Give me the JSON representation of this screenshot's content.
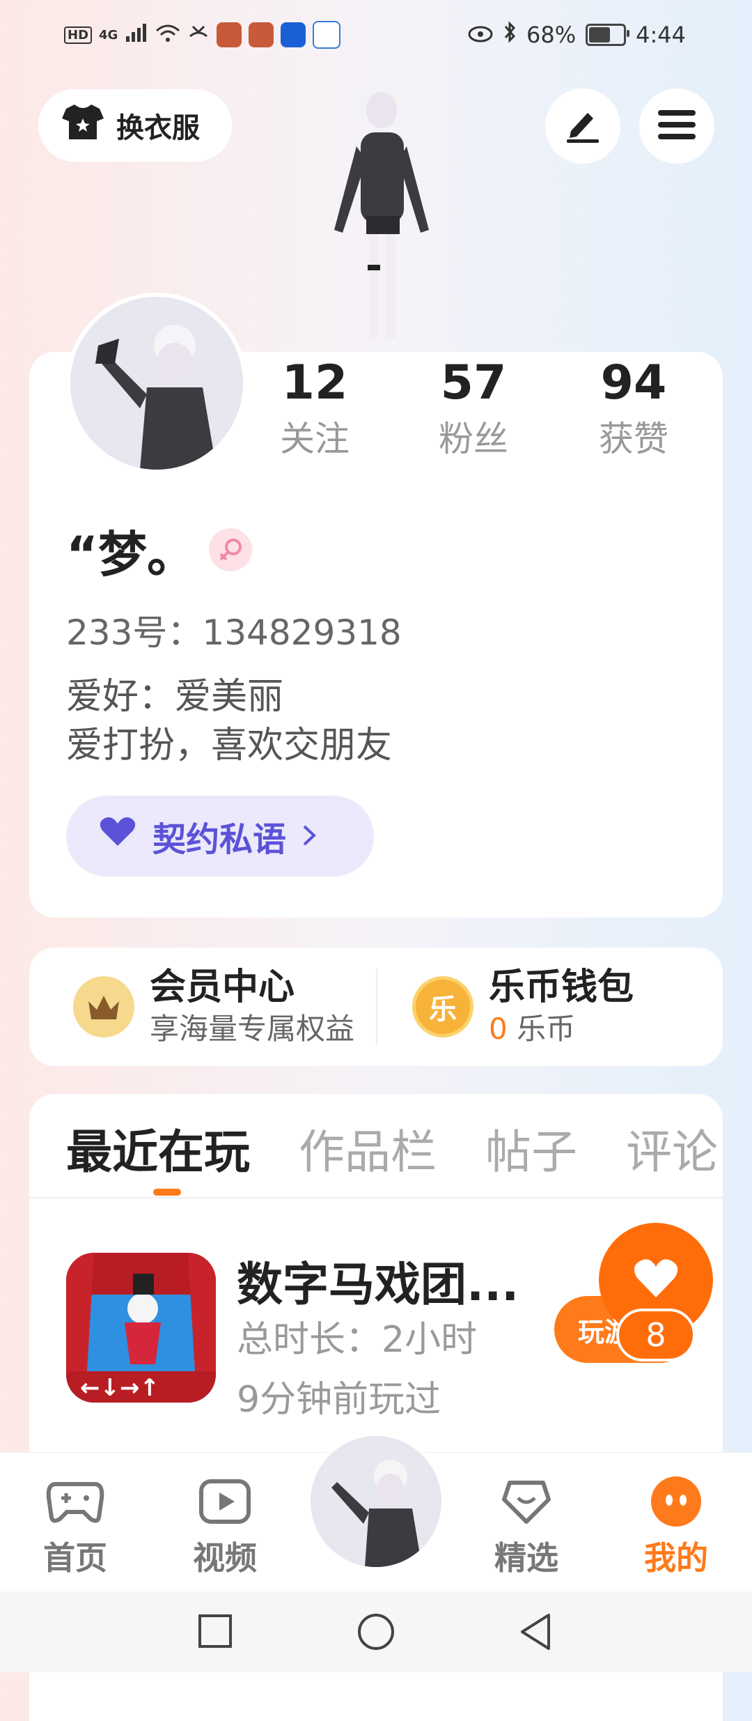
{
  "status_bar": {
    "left_label": "HD",
    "network": "4G",
    "battery_text": "68%",
    "battery_level": 0.68,
    "time": "4:44"
  },
  "top_bar": {
    "change_outfit_label": "换衣服"
  },
  "profile": {
    "stats": [
      {
        "value": "12",
        "label": "关注"
      },
      {
        "value": "57",
        "label": "粉丝"
      },
      {
        "value": "94",
        "label": "获赞"
      }
    ],
    "username": "“梦。",
    "uid_text": "233号：134829318",
    "bio_line1": "爱好：爱美丽",
    "bio_line2": "爱打扮，喜欢交朋友",
    "contract_label": "契约私语"
  },
  "member_center": {
    "title": "会员中心",
    "subtitle": "享海量专属权益"
  },
  "wallet": {
    "title": "乐币钱包",
    "coin_char": "乐",
    "amount": "0",
    "unit": "乐币"
  },
  "recent": {
    "tabs": [
      "最近在玩",
      "作品栏",
      "帖子",
      "评论"
    ],
    "active_tab_index": 0,
    "game": {
      "title": "数字马戏团...",
      "duration": "总时长：2小时",
      "last_played": "9分钟前玩过",
      "play_label": "玩游戏"
    },
    "like_count": "8"
  },
  "bottom_nav": {
    "items": [
      {
        "label": "首页"
      },
      {
        "label": "视频"
      },
      {
        "label": "精选"
      },
      {
        "label": "我的"
      }
    ],
    "active_index": 3
  },
  "colors": {
    "accent": "#ff7a1a",
    "contract_text": "#5c52d8",
    "contract_bg": "#ebe9fb",
    "gender_pink": "#f08aa4",
    "gold": "#f6c65b"
  }
}
